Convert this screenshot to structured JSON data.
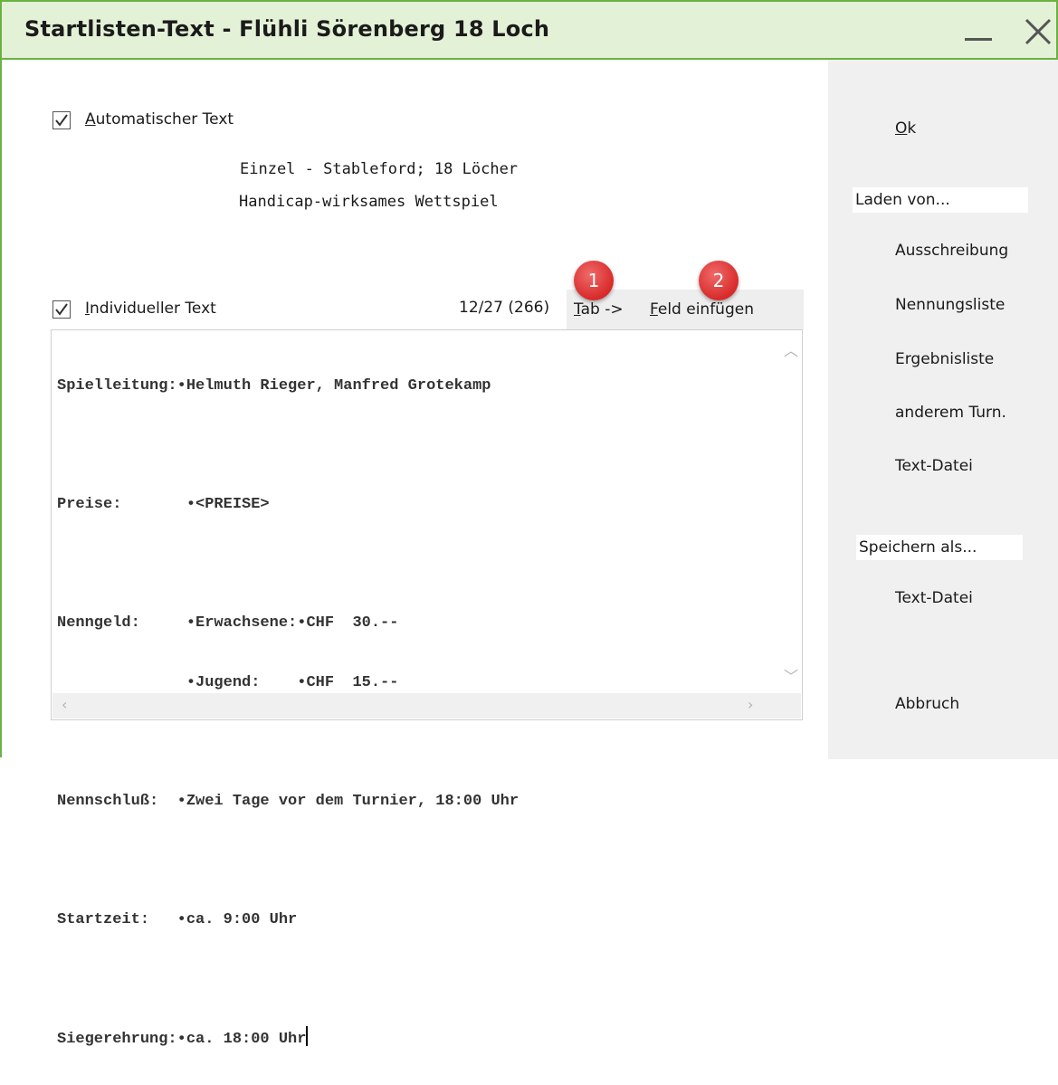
{
  "window": {
    "title": "Startlisten-Text - Flühli Sörenberg 18 Loch"
  },
  "auto_text": {
    "label_prefix": "A",
    "label_rest": "utomatischer Text",
    "checked": true,
    "lines": [
      "Einzel - Stableford; 18 Löcher",
      "Handicap-wirksames Wettspiel"
    ]
  },
  "individual_text": {
    "label_prefix": "I",
    "label_rest": "ndividueller Text",
    "checked": true,
    "counter": "12/27 (266)",
    "tab_prefix": "T",
    "tab_rest": "ab ->",
    "insert_prefix": "F",
    "insert_rest": "eld einfügen",
    "lines": [
      "Spielleitung:•Helmuth Rieger, Manfred Grotekamp",
      "",
      "Preise:       •<PREISE>",
      "",
      "Nenngeld:     •Erwachsene:•CHF  30.--",
      "              •Jugend:    •CHF  15.--",
      "",
      "Nennschluß:  •Zwei Tage vor dem Turnier, 18:00 Uhr",
      "",
      "Startzeit:   •ca. 9:00 Uhr",
      "",
      "Siegerehrung:•ca. 18:00 Uhr"
    ]
  },
  "badges": [
    "1",
    "2"
  ],
  "sidebar": {
    "ok_prefix": "O",
    "ok_rest": "k",
    "load_group": "Laden von...",
    "load_items": [
      "Ausschreibung",
      "Nennungsliste",
      "Ergebnisliste",
      "anderem Turn.",
      "Text-Datei"
    ],
    "save_group": "Speichern als...",
    "save_items": [
      "Text-Datei"
    ],
    "cancel": "Abbruch"
  },
  "colors": {
    "title_bg": "#e3f1d6",
    "border": "#6bb143",
    "badge": "#d82a2a"
  }
}
